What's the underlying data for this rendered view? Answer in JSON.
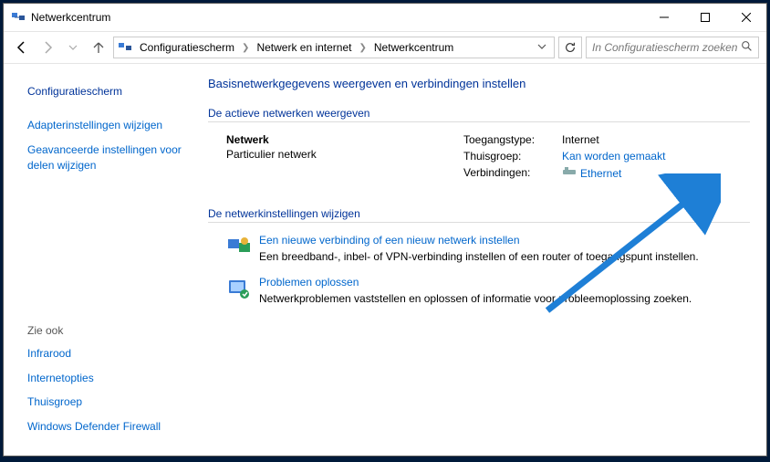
{
  "window": {
    "title": "Netwerkcentrum"
  },
  "breadcrumbs": {
    "a": "Configuratiescherm",
    "b": "Netwerk en internet",
    "c": "Netwerkcentrum"
  },
  "search": {
    "placeholder": "In Configuratiescherm zoeken"
  },
  "sidebar": {
    "head": "Configuratiescherm",
    "l1": "Adapterinstellingen wijzigen",
    "l2": "Geavanceerde instellingen voor delen wijzigen",
    "seeAlso": "Zie ook",
    "s1": "Infrarood",
    "s2": "Internetopties",
    "s3": "Thuisgroep",
    "s4": "Windows Defender Firewall"
  },
  "main": {
    "title": "Basisnetwerkgegevens weergeven en verbindingen instellen",
    "activeHead": "De actieve netwerken weergeven",
    "netName": "Netwerk",
    "netType": "Particulier netwerk",
    "accessLabel": "Toegangstype:",
    "accessVal": "Internet",
    "homeLabel": "Thuisgroep:",
    "homeVal": "Kan worden gemaakt",
    "connLabel": "Verbindingen:",
    "connVal": "Ethernet",
    "settingsHead": "De netwerkinstellingen wijzigen",
    "task1Title": "Een nieuwe verbinding of een nieuw netwerk instellen",
    "task1Desc": "Een breedband-, inbel- of VPN-verbinding instellen of een router of toegangspunt instellen.",
    "task2Title": "Problemen oplossen",
    "task2Desc": "Netwerkproblemen vaststellen en oplossen of informatie voor probleemoplossing zoeken."
  }
}
